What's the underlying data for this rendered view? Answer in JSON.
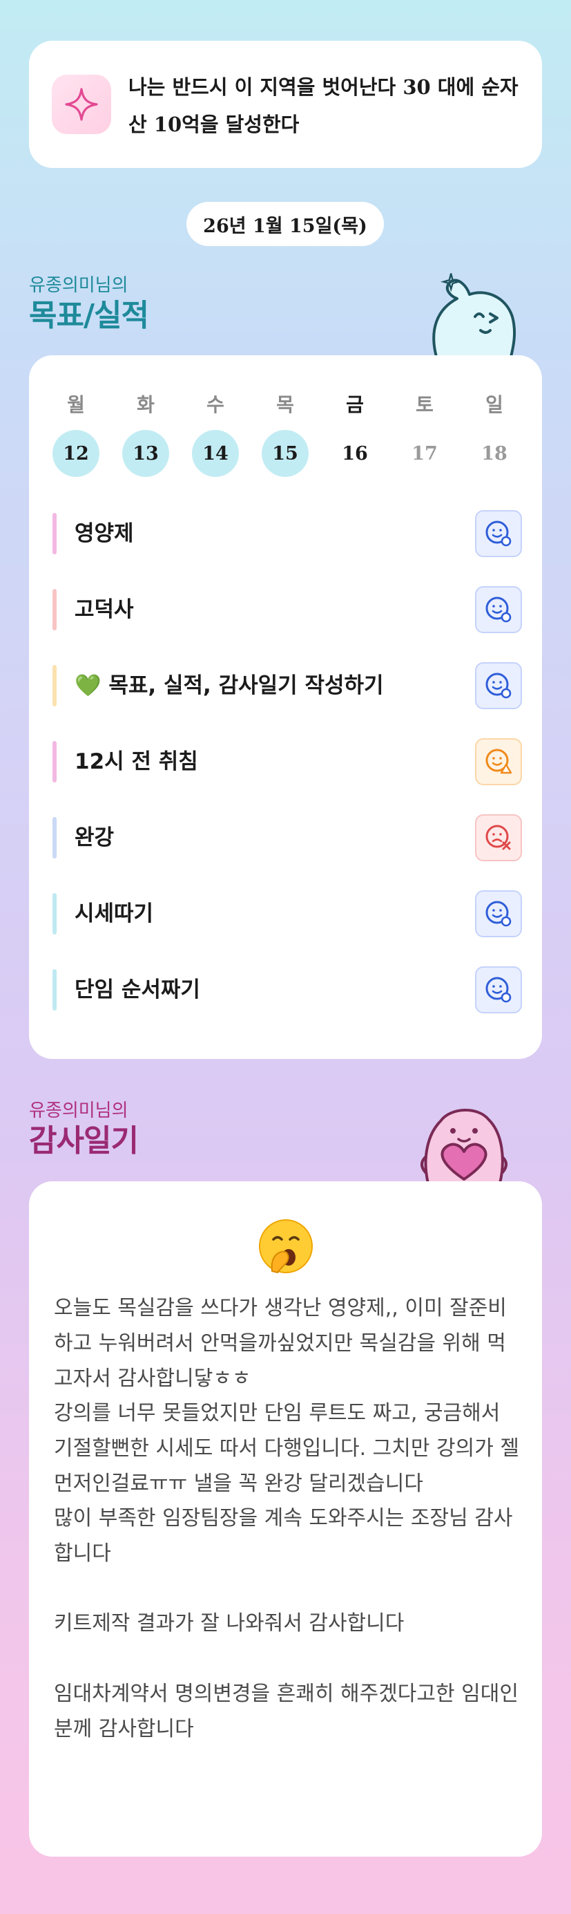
{
  "goal_banner": {
    "icon": "sparkle-icon",
    "text": "나는 반드시 이 지역을 벗어난다 30 대에 순자산 10억을 달성한다"
  },
  "date_label": "26년 1월 15일(목)",
  "goals_section": {
    "owner": "유종의미님의",
    "title": "목표/실적"
  },
  "week": {
    "days": [
      "월",
      "화",
      "수",
      "목",
      "금",
      "토",
      "일"
    ],
    "dates": [
      "12",
      "13",
      "14",
      "15",
      "16",
      "17",
      "18"
    ]
  },
  "goals": [
    {
      "label": "영양제",
      "status": "smile-check-icon",
      "bar_color": "#f3b8e2"
    },
    {
      "label": "고덕사",
      "status": "smile-check-icon",
      "bar_color": "#f8c4c4"
    },
    {
      "label": "💚 목표, 실적, 감사일기 작성하기",
      "status": "smile-check-icon",
      "bar_color": "#fbe1b0"
    },
    {
      "label": "12시 전 취침",
      "status": "smile-warning-icon",
      "bar_color": "#f3b8e2"
    },
    {
      "label": "완강",
      "status": "sad-x-icon",
      "bar_color": "#c9d9f6"
    },
    {
      "label": "시세따기",
      "status": "smile-check-icon",
      "bar_color": "#bfeaf2"
    },
    {
      "label": "단임 순서짜기",
      "status": "smile-check-icon",
      "bar_color": "#bfeaf2"
    }
  ],
  "gratitude_section": {
    "owner": "유종의미님의",
    "title": "감사일기",
    "emoji": "yawning-face-icon",
    "entries": [
      "오늘도 목실감을 쓰다가 생각난 영양제,, 이미 잘준비하고 누워버려서 안먹을까싶었지만 목실감을 위해 먹고자서 감사합니닿ㅎㅎ",
      "강의를 너무 못들었지만 단임 루트도 짜고, 궁금해서 기절할뻔한 시세도 따서 다행입니다. 그치만 강의가 젤 먼저인걸료ㅠㅠ 낼을 꼭 완강 달리겠습니다",
      "많이 부족한 임장팀장을 계속 도와주시는 조장님 감사합니다",
      "키트제작 결과가 잘 나와줘서 감사합니다",
      "임대차계약서 명의변경을 흔쾌히 해주겠다고한 임대인분께 감사합니다"
    ]
  },
  "colors": {
    "accent_teal": "#1e8a9a",
    "accent_magenta": "#b0307f",
    "status_good": "#2f5ed8",
    "status_warn": "#f08a1c",
    "status_bad": "#e04848"
  }
}
